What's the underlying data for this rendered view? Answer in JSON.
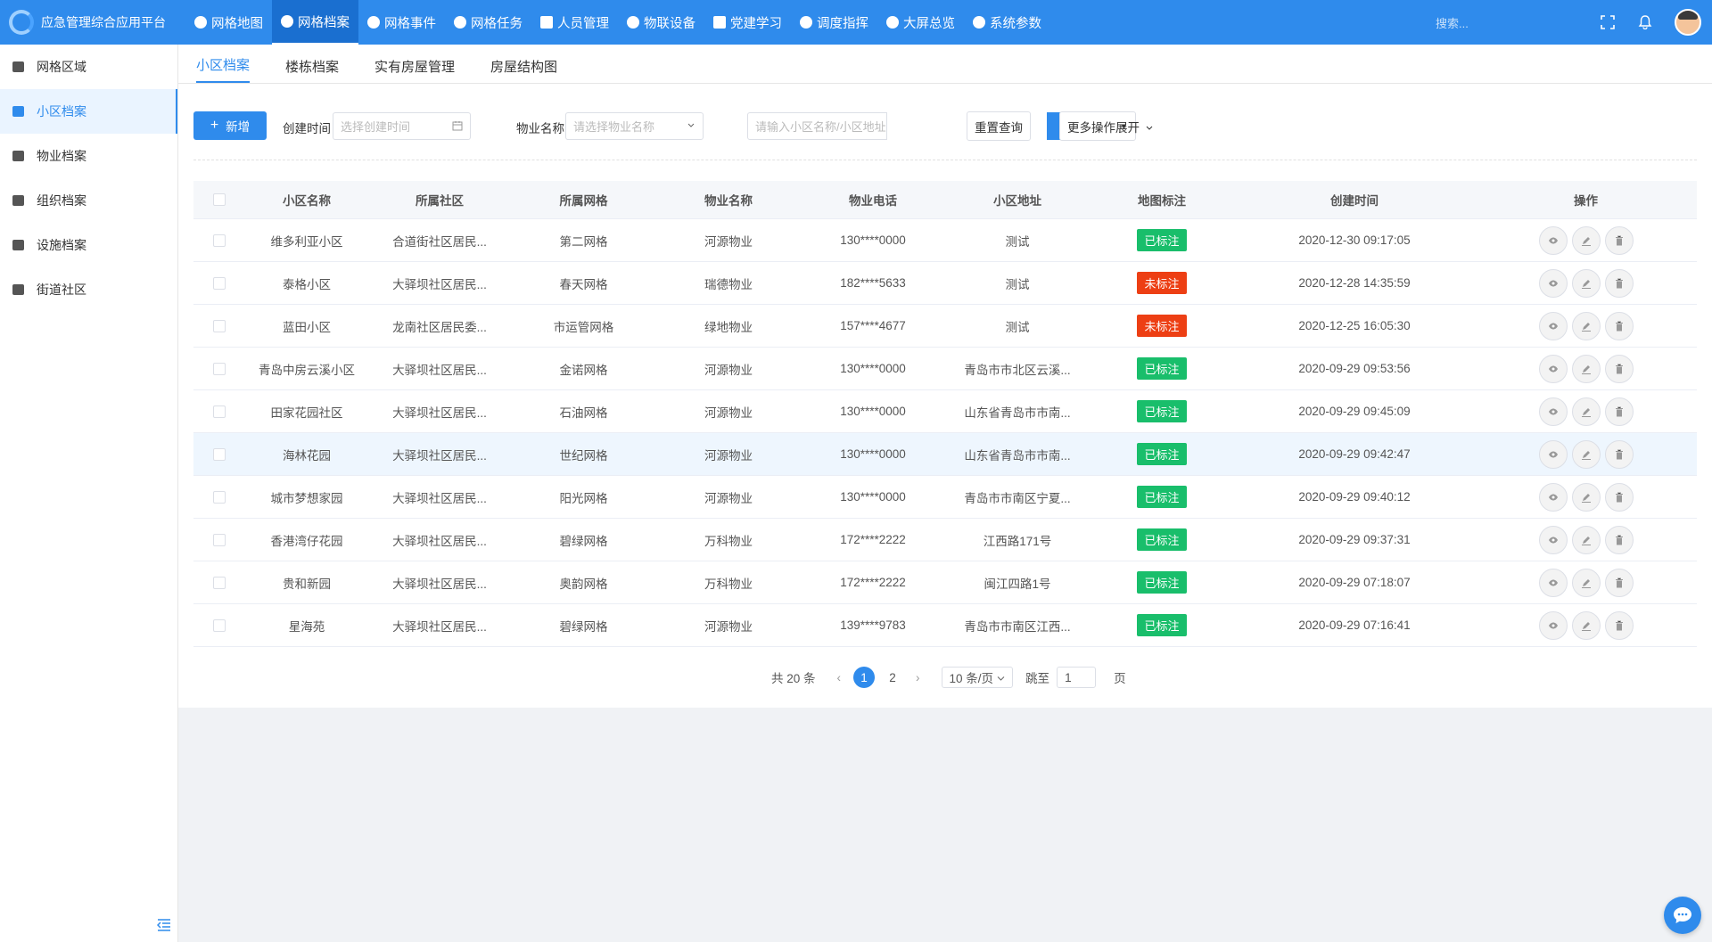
{
  "app": {
    "title": "应急管理综合应用平台"
  },
  "topnav": [
    {
      "label": "网格地图"
    },
    {
      "label": "网格档案"
    },
    {
      "label": "网格事件"
    },
    {
      "label": "网格任务"
    },
    {
      "label": "人员管理"
    },
    {
      "label": "物联设备"
    },
    {
      "label": "党建学习"
    },
    {
      "label": "调度指挥"
    },
    {
      "label": "大屏总览"
    },
    {
      "label": "系统参数"
    }
  ],
  "top_search": {
    "placeholder": "搜索..."
  },
  "sidebar": {
    "items": [
      {
        "label": "网格区域"
      },
      {
        "label": "小区档案"
      },
      {
        "label": "物业档案"
      },
      {
        "label": "组织档案"
      },
      {
        "label": "设施档案"
      },
      {
        "label": "街道社区"
      }
    ]
  },
  "subtabs": [
    {
      "label": "小区档案"
    },
    {
      "label": "楼栋档案"
    },
    {
      "label": "实有房屋管理"
    },
    {
      "label": "房屋结构图"
    }
  ],
  "filter": {
    "add_label": "新增",
    "created_label": "创建时间",
    "created_placeholder": "选择创建时间",
    "property_label": "物业名称",
    "property_placeholder": "请选择物业名称",
    "keyword_placeholder": "请输入小区名称/小区地址",
    "reset_label": "重置查询",
    "more_label": "更多操作",
    "expand_label": "展开"
  },
  "table": {
    "headers": [
      "小区名称",
      "所属社区",
      "所属网格",
      "物业名称",
      "物业电话",
      "小区地址",
      "地图标注",
      "创建时间",
      "操作"
    ],
    "rows": [
      {
        "name": "维多利亚小区",
        "community": "合道街社区居民...",
        "grid": "第二网格",
        "property": "河源物业",
        "phone": "130****0000",
        "address": "测试",
        "mark": "已标注",
        "marked": true,
        "created": "2020-12-30 09:17:05"
      },
      {
        "name": "泰格小区",
        "community": "大驿坝社区居民...",
        "grid": "春天网格",
        "property": "瑞德物业",
        "phone": "182****5633",
        "address": "测试",
        "mark": "未标注",
        "marked": false,
        "created": "2020-12-28 14:35:59"
      },
      {
        "name": "蓝田小区",
        "community": "龙南社区居民委...",
        "grid": "市运管网格",
        "property": "绿地物业",
        "phone": "157****4677",
        "address": "测试",
        "mark": "未标注",
        "marked": false,
        "created": "2020-12-25 16:05:30"
      },
      {
        "name": "青岛中房云溪小区",
        "community": "大驿坝社区居民...",
        "grid": "金诺网格",
        "property": "河源物业",
        "phone": "130****0000",
        "address": "青岛市市北区云溪...",
        "mark": "已标注",
        "marked": true,
        "created": "2020-09-29 09:53:56"
      },
      {
        "name": "田家花园社区",
        "community": "大驿坝社区居民...",
        "grid": "石油网格",
        "property": "河源物业",
        "phone": "130****0000",
        "address": "山东省青岛市市南...",
        "mark": "已标注",
        "marked": true,
        "created": "2020-09-29 09:45:09"
      },
      {
        "name": "海林花园",
        "community": "大驿坝社区居民...",
        "grid": "世纪网格",
        "property": "河源物业",
        "phone": "130****0000",
        "address": "山东省青岛市市南...",
        "mark": "已标注",
        "marked": true,
        "created": "2020-09-29 09:42:47"
      },
      {
        "name": "城市梦想家园",
        "community": "大驿坝社区居民...",
        "grid": "阳光网格",
        "property": "河源物业",
        "phone": "130****0000",
        "address": "青岛市市南区宁夏...",
        "mark": "已标注",
        "marked": true,
        "created": "2020-09-29 09:40:12"
      },
      {
        "name": "香港湾仔花园",
        "community": "大驿坝社区居民...",
        "grid": "碧绿网格",
        "property": "万科物业",
        "phone": "172****2222",
        "address": "江西路171号",
        "mark": "已标注",
        "marked": true,
        "created": "2020-09-29 09:37:31"
      },
      {
        "name": "贵和新园",
        "community": "大驿坝社区居民...",
        "grid": "奥韵网格",
        "property": "万科物业",
        "phone": "172****2222",
        "address": "闽江四路1号",
        "mark": "已标注",
        "marked": true,
        "created": "2020-09-29 07:18:07"
      },
      {
        "name": "星海苑",
        "community": "大驿坝社区居民...",
        "grid": "碧绿网格",
        "property": "河源物业",
        "phone": "139****9783",
        "address": "青岛市市南区江西...",
        "mark": "已标注",
        "marked": true,
        "created": "2020-09-29 07:16:41"
      }
    ]
  },
  "pagination": {
    "total_text": "共 20 条",
    "pages": [
      "1",
      "2"
    ],
    "current": "1",
    "page_size": "10 条/页",
    "jump_label": "跳至",
    "jump_value": "1",
    "jump_unit": "页"
  },
  "colors": {
    "primary": "#2f8bec",
    "marked": "#19be6b",
    "unmarked": "#ed3f14"
  }
}
